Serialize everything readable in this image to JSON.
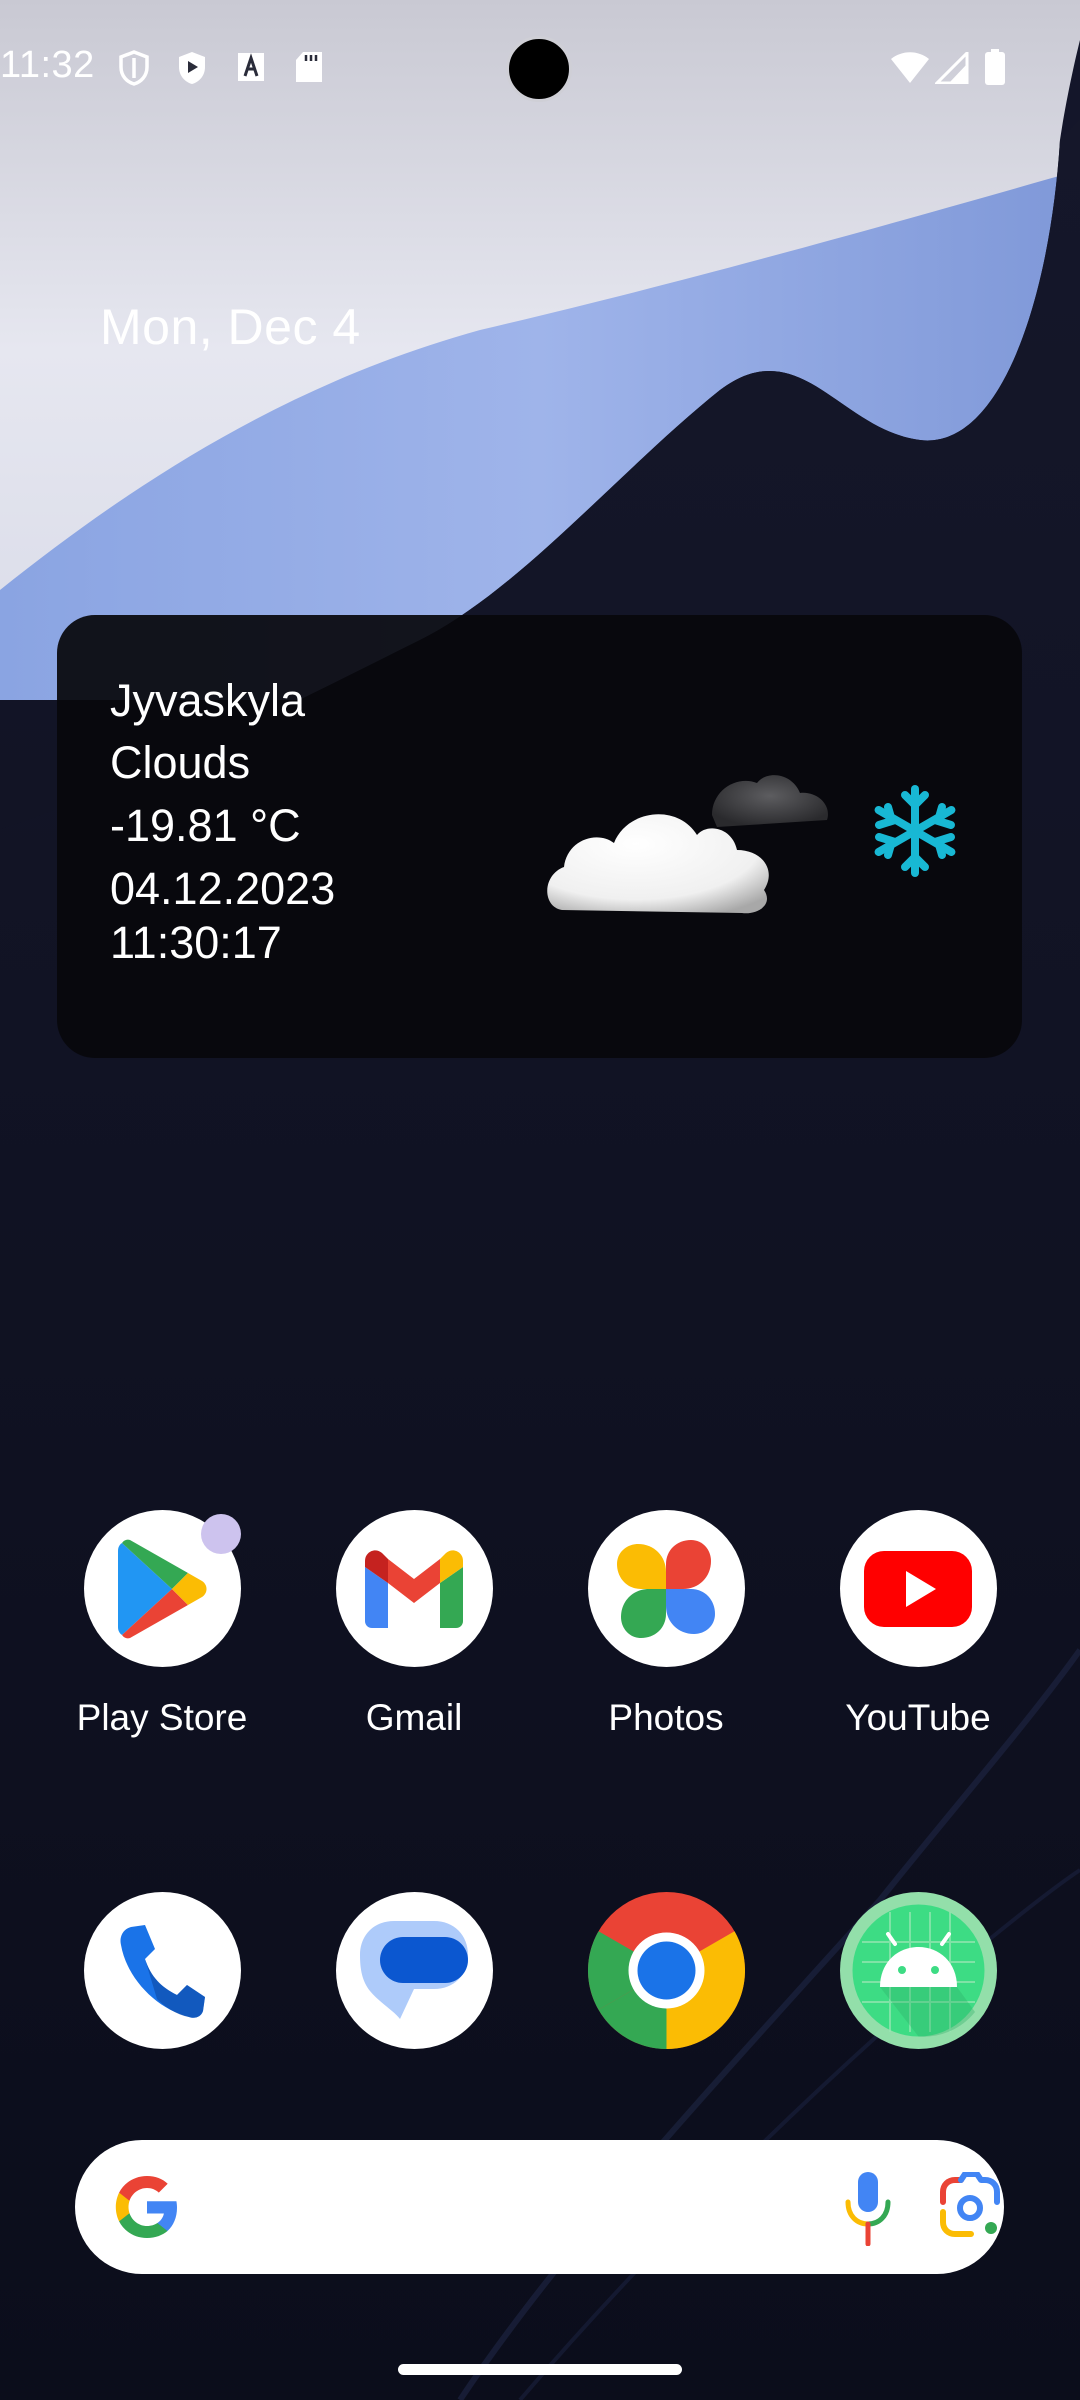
{
  "status_bar": {
    "time": "11:32",
    "left_icons": [
      "shield-outline-icon",
      "shield-play-icon",
      "font-a-icon",
      "sd-card-icon"
    ],
    "right_icons": [
      "wifi-icon",
      "cellular-signal-icon",
      "battery-icon"
    ]
  },
  "home": {
    "date": "Mon, Dec 4"
  },
  "weather_widget": {
    "city": "Jyvaskyla",
    "condition": "Clouds",
    "temperature": "-19.81 °C",
    "date": "04.12.2023",
    "time": "11:30:17",
    "condition_icon": "cloud-icon",
    "temp_icon": "snowflake-icon",
    "snow_color": "#18b8d4"
  },
  "apps_row1": [
    {
      "label": "Play Store",
      "icon": "play-store-icon",
      "has_notification": true
    },
    {
      "label": "Gmail",
      "icon": "gmail-icon"
    },
    {
      "label": "Photos",
      "icon": "photos-icon"
    },
    {
      "label": "YouTube",
      "icon": "youtube-icon"
    }
  ],
  "dock": [
    {
      "icon": "phone-icon"
    },
    {
      "icon": "messages-icon"
    },
    {
      "icon": "chrome-icon"
    },
    {
      "icon": "android-icon"
    }
  ],
  "search_bar": {
    "logo": "google-g-icon",
    "mic": "microphone-icon",
    "lens": "google-lens-icon"
  }
}
